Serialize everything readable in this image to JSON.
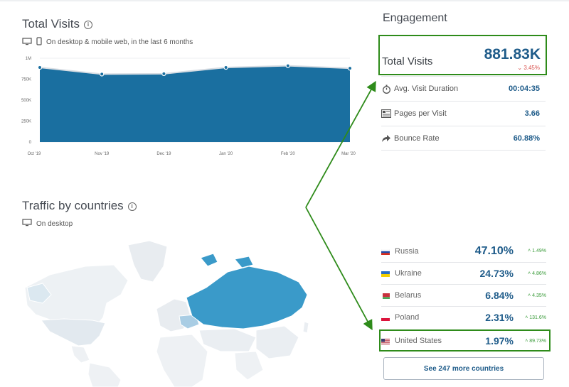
{
  "total_visits_section": {
    "title": "Total Visits",
    "subtitle": "On desktop & mobile web, in the last 6 months"
  },
  "chart_data": {
    "type": "area",
    "categories": [
      "Oct '19",
      "Nov '19",
      "Dec '19",
      "Jan '20",
      "Feb '20",
      "Mar '20"
    ],
    "values": [
      890000,
      810000,
      815000,
      890000,
      910000,
      880000
    ],
    "ylim": [
      0,
      1000000
    ],
    "yticks": [
      "0",
      "250K",
      "500K",
      "750K",
      "1M"
    ],
    "ytick_values": [
      0,
      250000,
      500000,
      750000,
      1000000
    ],
    "colors": {
      "fill": "#1a6fa0",
      "line": "#d8dde3",
      "marker": "#1a6fa0"
    }
  },
  "traffic_section": {
    "title": "Traffic by countries",
    "subtitle": "On desktop"
  },
  "engagement": {
    "title": "Engagement",
    "total_visits_label": "Total Visits",
    "total_visits_value": "881.83K",
    "total_visits_change": "3.45%",
    "metrics": [
      {
        "label": "Avg. Visit Duration",
        "value": "00:04:35",
        "icon": "stopwatch-icon"
      },
      {
        "label": "Pages per Visit",
        "value": "3.66",
        "icon": "pages-icon"
      },
      {
        "label": "Bounce Rate",
        "value": "60.88%",
        "icon": "bounce-arrow-icon"
      }
    ]
  },
  "countries": [
    {
      "name": "Russia",
      "pct": "47.10%",
      "change": "1.49%",
      "flag": "russia"
    },
    {
      "name": "Ukraine",
      "pct": "24.73%",
      "change": "4.86%",
      "flag": "ukraine"
    },
    {
      "name": "Belarus",
      "pct": "6.84%",
      "change": "4.35%",
      "flag": "belarus"
    },
    {
      "name": "Poland",
      "pct": "2.31%",
      "change": "131.6%",
      "flag": "poland"
    },
    {
      "name": "United States",
      "pct": "1.97%",
      "change": "89.73%",
      "flag": "usa"
    }
  ],
  "more_button": "See 247 more countries",
  "colors": {
    "accent": "#1f5c8a",
    "highlight": "#2e8b1a",
    "positive": "#3a9b3a",
    "negative": "#d9534f"
  }
}
